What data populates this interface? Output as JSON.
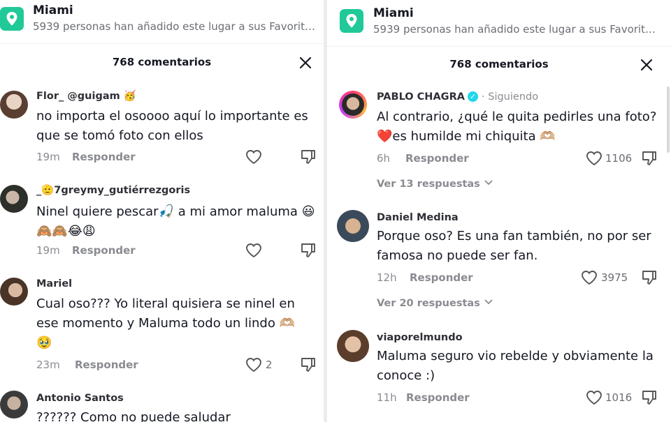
{
  "left": {
    "location": {
      "title": "Miami",
      "subtitle": "5939 personas han añadido este lugar a sus Favorit…"
    },
    "header": {
      "title": "768 comentarios"
    },
    "comments": [
      {
        "user": "Flor_ @guigam 🥳",
        "text": "no importa el osoooo aquí lo importante es que se tomó foto con ellos",
        "time": "19m",
        "reply": "Responder",
        "likes": ""
      },
      {
        "user": "_🫡7greymy_gutiérrezgoris",
        "text": "Ninel quiere pescar🎣 a mi amor maluma 😃🙈🙈😂😩",
        "time": "19m",
        "reply": "Responder",
        "likes": ""
      },
      {
        "user": "Mariel",
        "text": "Cual oso??? Yo literal quisiera se ninel en ese momento y Maluma todo un lindo 🫶🏼 🥹",
        "time": "23m",
        "reply": "Responder",
        "likes": "2"
      },
      {
        "user": "Antonio Santos",
        "text": "?????? Como no puede saludar",
        "time": "",
        "reply": "",
        "likes": ""
      }
    ]
  },
  "right": {
    "location": {
      "title": "Miami",
      "subtitle": "5939 personas han añadido este lugar a sus Favorit…"
    },
    "header": {
      "title": "768 comentarios"
    },
    "comments": [
      {
        "user": "PABLO CHAGRA",
        "following": "· Siguiendo",
        "text": "Al contrario, ¿qué le quita pedirles una foto? ❤️es humilde mi chiquita 🫶🏼",
        "time": "6h",
        "reply": "Responder",
        "likes": "1106",
        "more": "Ver 13 respuestas"
      },
      {
        "user": "Daniel Medina",
        "text": "Porque oso? Es una fan también, no por ser famosa no puede ser fan.",
        "time": "12h",
        "reply": "Responder",
        "likes": "3975",
        "more": "Ver 20 respuestas"
      },
      {
        "user": "viaporelmundo",
        "text": "Maluma seguro vio rebelde y obviamente la conoce :)",
        "time": "11h",
        "reply": "Responder",
        "likes": "1016"
      }
    ]
  },
  "icons": {
    "location": "location-pin-icon",
    "close": "close-icon",
    "like": "heart-icon",
    "dislike": "thumbs-down-icon",
    "more": "chevron-down-icon",
    "verified": "verified-badge-icon"
  },
  "colors": {
    "accent": "#20c997",
    "text": "#161823",
    "muted": "#8a8b91",
    "verified": "#20d5ec"
  }
}
